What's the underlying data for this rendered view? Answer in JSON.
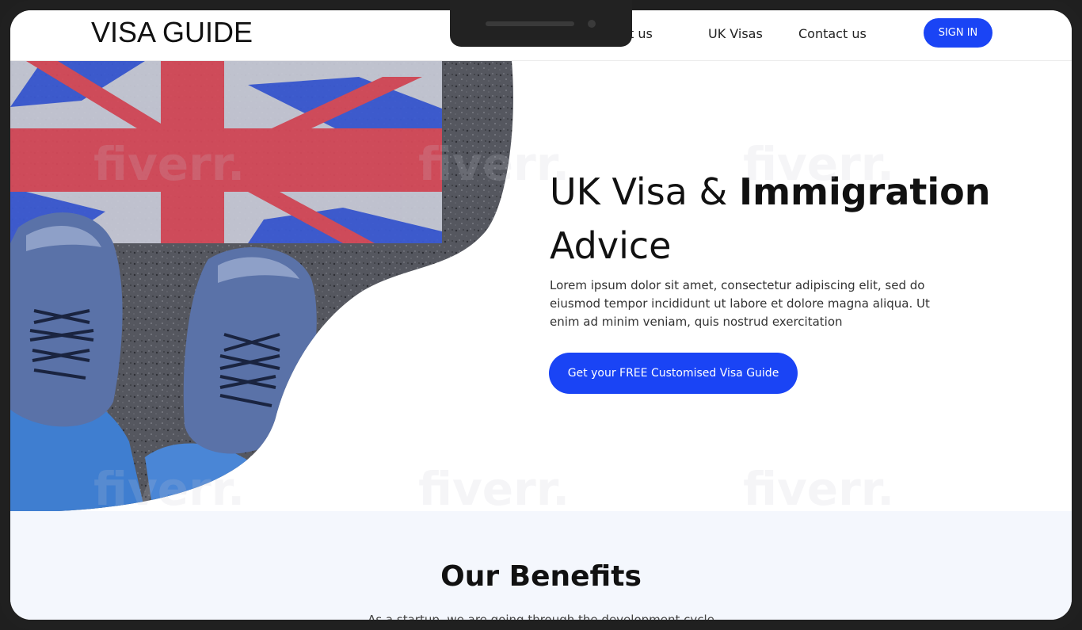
{
  "header": {
    "logo": "VISA GUIDE",
    "nav": [
      {
        "label": "About us"
      },
      {
        "label": "UK Visas"
      },
      {
        "label": "Contact us"
      }
    ],
    "signin_label": "SIGN IN"
  },
  "hero": {
    "title_light": "UK Visa & ",
    "title_bold": "Immigration",
    "title_line2": "Advice",
    "body": "Lorem ipsum dolor sit amet, consectetur adipiscing elit, sed do eiusmod tempor incididunt ut labore et dolore magna aliqua. Ut enim ad minim veniam, quis nostrud exercitation",
    "cta_label": "Get your FREE Customised Visa Guide"
  },
  "benefits": {
    "title": "Our Benefits",
    "subtitle": "As a startup, we are going through the development cycle"
  },
  "watermark": "fiverr.",
  "colors": {
    "accent": "#1a44f5",
    "text": "#111111",
    "benefits_bg": "#f4f7fd"
  },
  "icons": {
    "hero_image": "uk-flag-shoes-photo"
  }
}
